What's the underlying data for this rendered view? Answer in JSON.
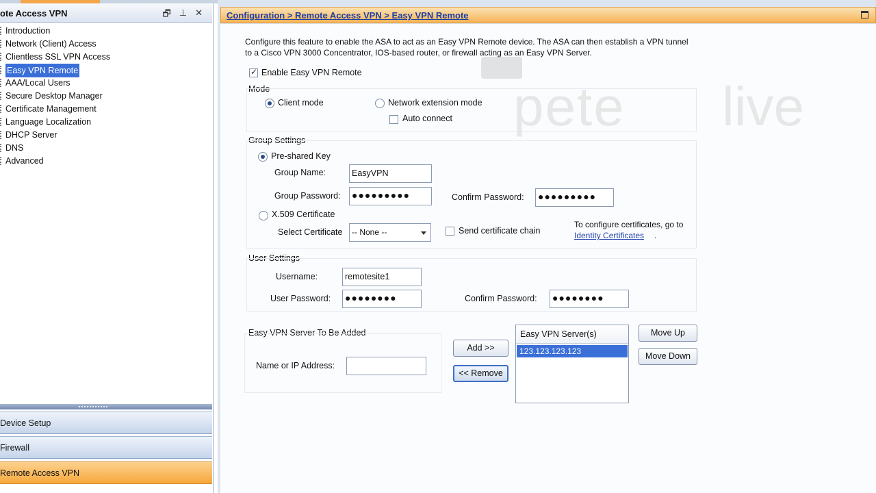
{
  "left_panel": {
    "title": "ote Access VPN",
    "header_icons": [
      "restore-icon",
      "pin-icon",
      "close-icon"
    ],
    "tree_items": [
      {
        "label": "Introduction"
      },
      {
        "label": "Network (Client) Access"
      },
      {
        "label": "Clientless SSL VPN Access"
      },
      {
        "label": "Easy VPN Remote",
        "selected": true
      },
      {
        "label": "AAA/Local Users"
      },
      {
        "label": "Secure Desktop Manager"
      },
      {
        "label": "Certificate Management"
      },
      {
        "label": "Language Localization"
      },
      {
        "label": "DHCP Server"
      },
      {
        "label": "DNS"
      },
      {
        "label": "Advanced"
      }
    ],
    "nav_buttons": [
      {
        "label": "Device Setup"
      },
      {
        "label": "Firewall"
      },
      {
        "label": "Remote Access VPN",
        "active": true
      }
    ]
  },
  "header": {
    "breadcrumb": "Configuration > Remote Access VPN > Easy VPN Remote"
  },
  "main": {
    "description": "Configure this feature to enable the ASA to act as an Easy VPN Remote device. The ASA can then establish a VPN tunnel to a Cisco VPN 3000 Concentrator, IOS-based router, or firewall acting as an Easy VPN Server.",
    "enable_label": "Enable Easy VPN Remote",
    "enable_checked": true,
    "mode": {
      "title": "Mode",
      "client_label": "Client mode",
      "network_label": "Network extension mode",
      "auto_connect_label": "Auto connect",
      "selected": "client"
    },
    "group": {
      "title": "Group Settings",
      "psk_label": "Pre-shared Key",
      "group_name_label": "Group Name:",
      "group_name_value": "EasyVPN",
      "group_password_label": "Group Password:",
      "group_password_value": "●●●●●●●●●",
      "confirm_label": "Confirm Password:",
      "confirm_value": "●●●●●●●●●",
      "x509_label": "X.509 Certificate",
      "select_cert_label": "Select Certificate",
      "select_cert_value": "-- None --",
      "send_chain_label": "Send certificate chain",
      "cert_hint": "To configure certificates, go to",
      "cert_link": "Identity Certificates",
      "cert_link_suffix": "."
    },
    "user": {
      "title": "User Settings",
      "username_label": "Username:",
      "username_value": "remotesite1",
      "password_label": "User Password:",
      "password_value": "●●●●●●●●",
      "confirm_label": "Confirm Password:",
      "confirm_value": "●●●●●●●●"
    },
    "server": {
      "title": "Easy VPN Server To Be Added",
      "name_label": "Name or IP Address:",
      "name_value": "",
      "add_label": "Add >>",
      "remove_label": "<< Remove",
      "list_header": "Easy VPN Server(s)",
      "list_items": [
        "123.123.123.123"
      ],
      "move_up_label": "Move Up",
      "move_down_label": "Move Down"
    }
  },
  "watermark": {
    "left": "pete",
    "right": "live"
  },
  "colors": {
    "accent_orange": "#f6b356",
    "selection_blue": "#3a6fd8",
    "link_blue": "#1b3fa8"
  }
}
